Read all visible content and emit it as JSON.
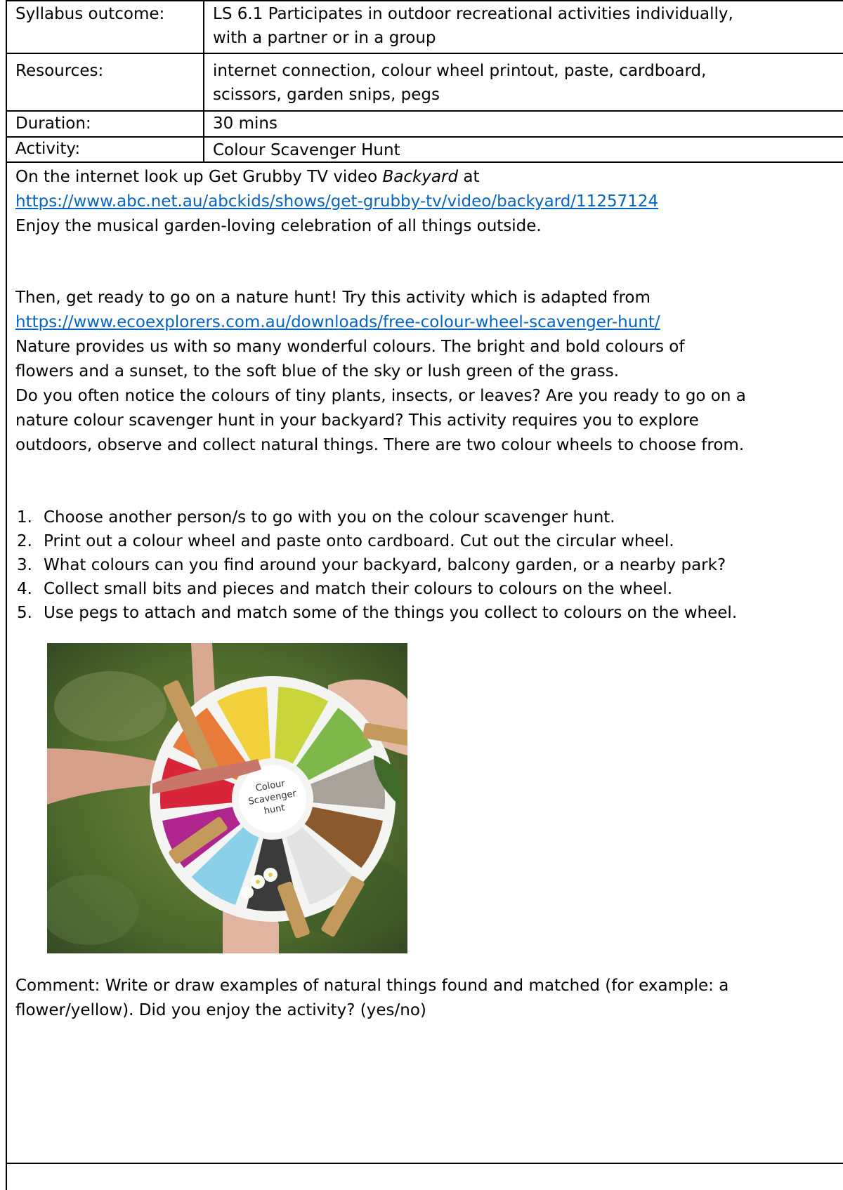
{
  "table": {
    "rows": [
      {
        "label": "Syllabus outcome:",
        "value_lines": [
          "LS 6.1 Participates in outdoor recreational activities individually,",
          "with a partner or in a group"
        ]
      },
      {
        "label": "Resources:",
        "value_lines": [
          "internet connection, colour wheel printout, paste, cardboard,",
          "scissors, garden snips, pegs"
        ]
      },
      {
        "label": "Duration:",
        "value_lines": [
          "30 mins"
        ]
      },
      {
        "label": "Activity:",
        "value_lines": [
          "Colour Scavenger Hunt"
        ]
      }
    ]
  },
  "body": {
    "intro_line1_prefix": "On the internet look up Get Grubby TV video",
    "intro_video_title": "Backyard",
    "intro_line1_suffix": "at",
    "link1": "https://www.abc.net.au/abckids/shows/get-grubby-tv/video/backyard/11257124",
    "enjoy_line": "Enjoy the musical garden-loving celebration of all things outside.",
    "then_line": "Then, get ready to go on a nature hunt! Try this activity which is adapted from",
    "link2": "https://www.ecoexplorers.com.au/downloads/free-colour-wheel-scavenger-hunt/",
    "para_lines": [
      "Nature provides us with so many wonderful colours. The bright and bold colours of",
      "flowers and a sunset, to the soft blue of the sky or lush green of the grass.",
      "Do you often notice the colours of tiny plants, insects, or leaves? Are you ready to go on a",
      "nature colour scavenger hunt in your backyard? This activity requires you to explore",
      "outdoors, observe and collect natural things. There are two colour wheels to choose from."
    ],
    "steps": [
      "Choose another person/s to go with you on the colour scavenger hunt.",
      "Print out a colour wheel and paste onto cardboard. Cut out the circular wheel.",
      "What colours can you find around your backyard, balcony garden, or a nearby park?",
      "Collect small bits and pieces and match their colours to colours on the wheel.",
      "Use pegs to attach and match some of the things you collect to colours on the wheel."
    ]
  },
  "photo": {
    "wheel_label_lines": [
      "Colour",
      "Scavenger",
      "hunt"
    ],
    "wheel_colors": [
      "#c9d33a",
      "#7fb84a",
      "#a9a29b",
      "#8a5a2e",
      "#e2e2e2",
      "#3b3b3b",
      "#8ad0e8",
      "#b0248e",
      "#d8253a",
      "#e87a3a",
      "#f2d03b"
    ]
  },
  "comment": {
    "lines": [
      "Comment: Write or draw examples of natural things found and matched (for example: a",
      "flower/yellow). Did you enjoy the activity? (yes/no)"
    ]
  }
}
